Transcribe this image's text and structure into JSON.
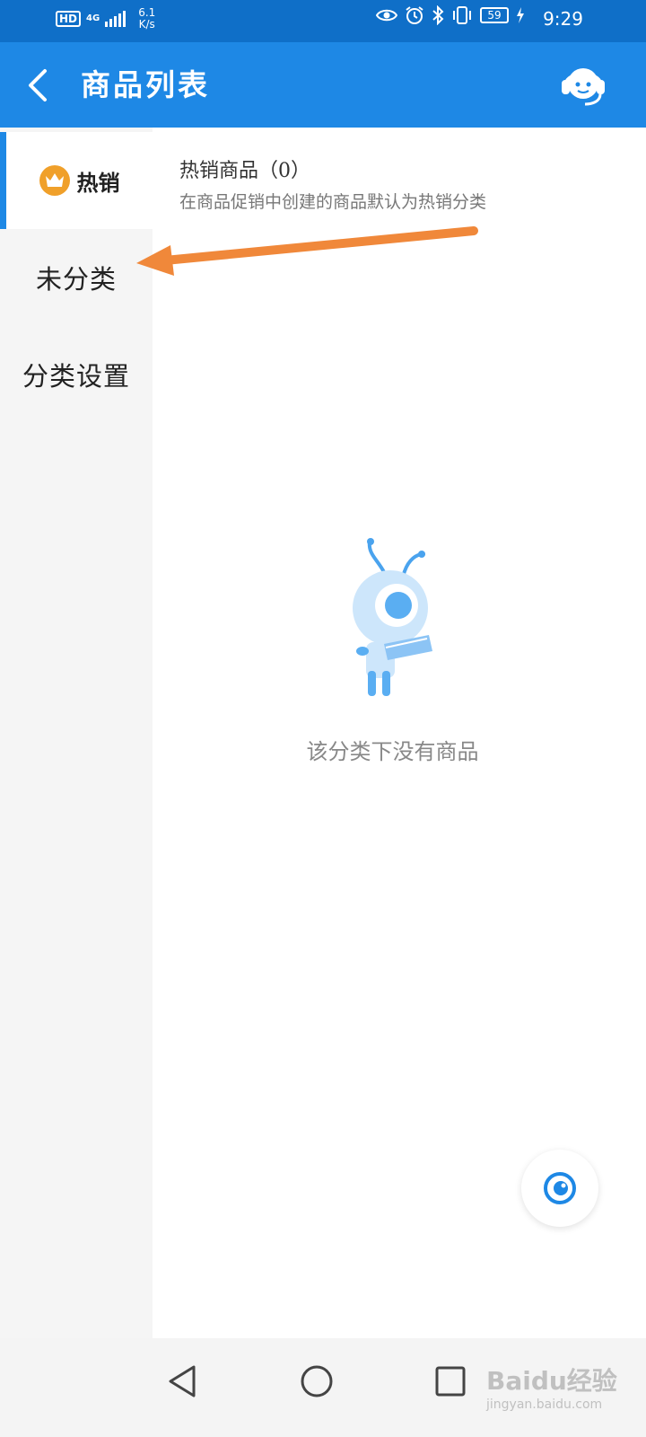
{
  "status_bar": {
    "hd": "HD",
    "network": "4G",
    "speed_value": "6.1",
    "speed_unit": "K/s",
    "battery": "59",
    "time": "9:29"
  },
  "app_bar": {
    "title": "商品列表",
    "back_icon": "chevron-left-icon",
    "support_icon": "customer-service-headset-icon"
  },
  "sidebar": {
    "items": [
      {
        "label": "热销",
        "icon": "crown-icon",
        "active": true
      },
      {
        "label": "未分类",
        "active": false
      },
      {
        "label": "分类设置",
        "active": false
      }
    ]
  },
  "content": {
    "section_title": "热销商品（0）",
    "section_subtitle": "在商品促销中创建的商品默认为热销分类",
    "empty_message": "该分类下没有商品",
    "empty_illustration": "ant-mascot-reading-icon"
  },
  "fab": {
    "icon": "eye-target-icon"
  },
  "nav_bar": {
    "back_icon": "triangle-back-icon",
    "home_icon": "circle-home-icon",
    "recents_icon": "square-recents-icon"
  },
  "watermark": {
    "logo": "Baidu经验",
    "url": "jingyan.baidu.com"
  },
  "colors": {
    "status_bar": "#0f6fc8",
    "app_bar": "#1e88e5",
    "accent": "#1e88e5",
    "crown": "#f0a02a",
    "annotation_arrow": "#f0883a",
    "sidebar_bg": "#f5f5f5"
  }
}
